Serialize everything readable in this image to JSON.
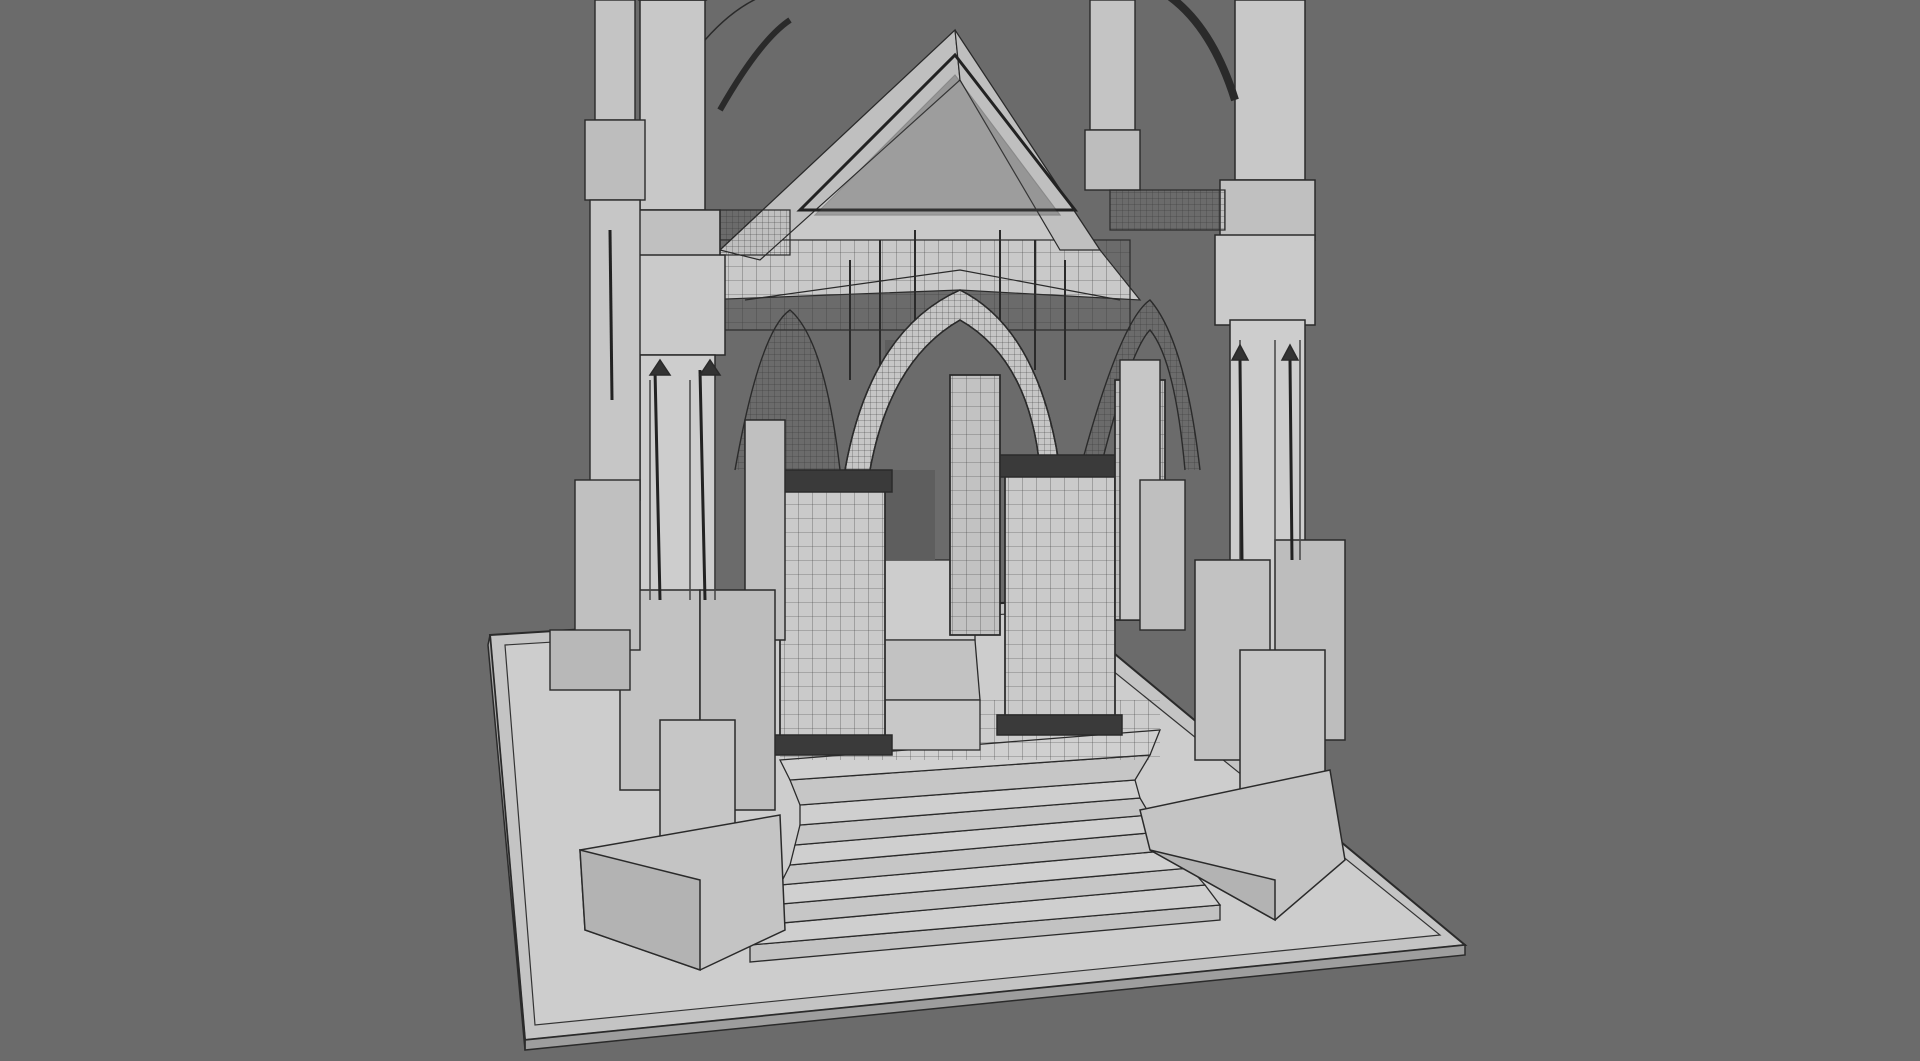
{
  "viewport": {
    "background_color": "#6b6b6b",
    "model_fill_color": "#c9c9c9",
    "model_shade_color": "#a9a9a9",
    "wire_color": "#2a2a2a",
    "subject": "gothic-monument-wireframe-model"
  }
}
